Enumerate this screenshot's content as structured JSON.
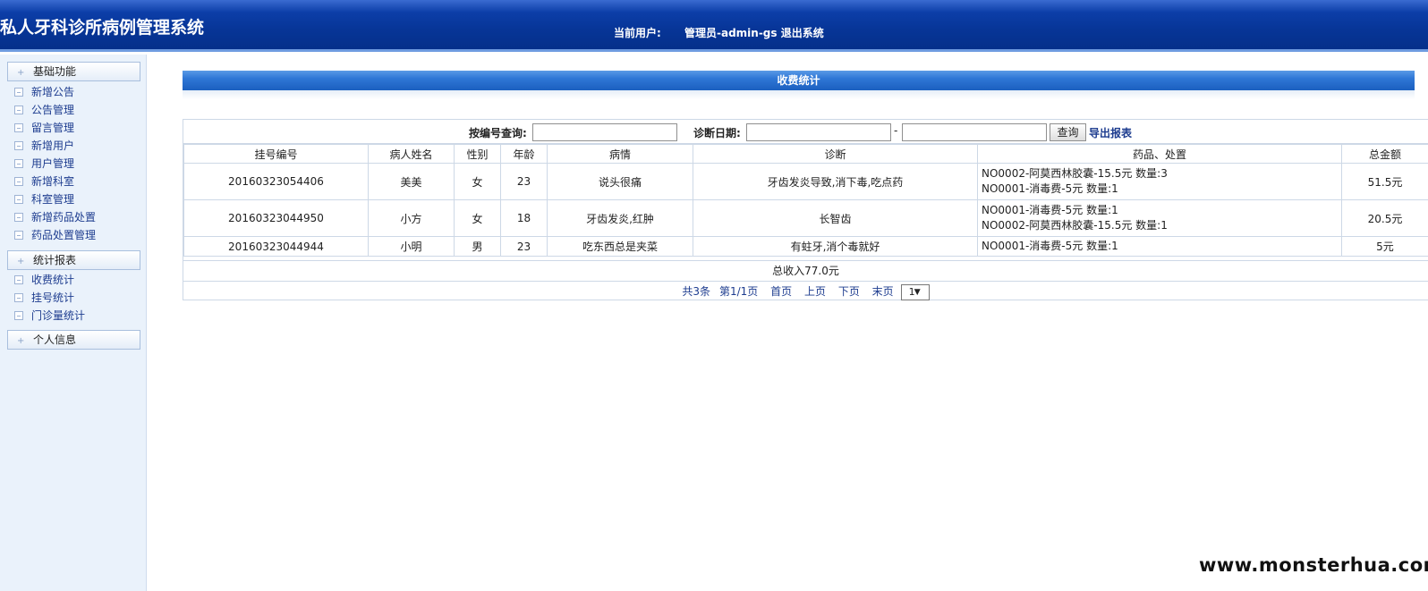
{
  "header": {
    "app_title": "私人牙科诊所病例管理系统",
    "current_user_label": "当前用户:",
    "user_name": "管理员-admin-gs",
    "logout_label": "退出系统",
    "colors": {
      "header_bg": "#073597",
      "section_bar": "#2f77d6",
      "link": "#1d3c8f"
    }
  },
  "sidebar": {
    "groups": [
      {
        "label": "基础功能",
        "items": [
          "新增公告",
          "公告管理",
          "留言管理",
          "新增用户",
          "用户管理",
          "新增科室",
          "科室管理",
          "新增药品处置",
          "药品处置管理"
        ]
      },
      {
        "label": "统计报表",
        "items": [
          "收费统计",
          "挂号统计",
          "门诊量统计"
        ]
      },
      {
        "label": "个人信息",
        "items": []
      }
    ]
  },
  "main": {
    "section_title": "收费统计",
    "search": {
      "id_label": "按编号查询:",
      "id_value": "",
      "date_label": "诊断日期:",
      "date_from": "",
      "date_sep": "-",
      "date_to": "",
      "query_label": "查询",
      "export_label": "导出报表"
    },
    "table": {
      "headers": [
        "挂号编号",
        "病人姓名",
        "性别",
        "年龄",
        "病情",
        "诊断",
        "药品、处置",
        "总金额"
      ],
      "rows": [
        {
          "reg_no": "20160323054406",
          "name": "美美",
          "gender": "女",
          "age": "23",
          "condition": "说头很痛",
          "diagnosis": "牙齿发炎导致,消下毒,吃点药",
          "drug_lines": [
            "NO0002-阿莫西林胶囊-15.5元  数量:3",
            "NO0001-消毒费-5元  数量:1"
          ],
          "total": "51.5元"
        },
        {
          "reg_no": "20160323044950",
          "name": "小方",
          "gender": "女",
          "age": "18",
          "condition": "牙齿发炎,红肿",
          "diagnosis": "长智齿",
          "drug_lines": [
            "NO0001-消毒费-5元  数量:1",
            "NO0002-阿莫西林胶囊-15.5元  数量:1"
          ],
          "total": "20.5元"
        },
        {
          "reg_no": "20160323044944",
          "name": "小明",
          "gender": "男",
          "age": "23",
          "condition": "吃东西总是夹菜",
          "diagnosis": "有蛀牙,消个毒就好",
          "drug_lines": [
            "NO0001-消毒费-5元  数量:1"
          ],
          "total": "5元"
        }
      ]
    },
    "summary": "总收入77.0元",
    "pager": {
      "total": "共3条",
      "page": "第1/1页",
      "first": "首页",
      "prev": "上页",
      "next": "下页",
      "last": "末页",
      "select_value": "1"
    }
  },
  "watermark": "www.monsterhua.com"
}
